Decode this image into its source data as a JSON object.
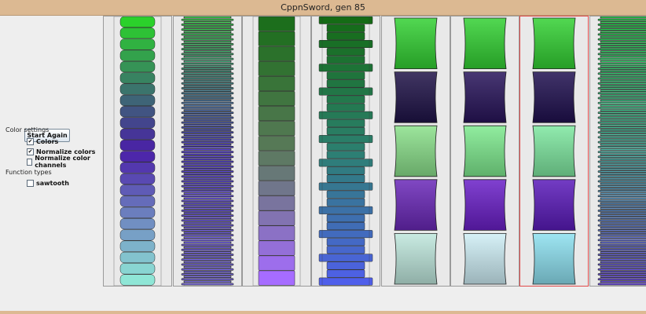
{
  "window": {
    "title": "CppnSword, gen 85"
  },
  "sidebar": {
    "start_again_label": "Start Again",
    "color_settings_label": "Color settings",
    "color_options": [
      {
        "label": "Colors",
        "checked": true
      },
      {
        "label": "Normalize colors",
        "checked": true
      },
      {
        "label": "Normalize color channels",
        "checked": false
      }
    ],
    "function_types_label": "Function types",
    "function_options": [
      {
        "label": "sawtooth",
        "checked": false
      }
    ]
  },
  "gallery": {
    "selected_index": 6,
    "panels": [
      {
        "name": "sword-0",
        "pattern": "waves",
        "colors": [
          "#2bd12b",
          "#4a1ea8",
          "#8fe6d6"
        ]
      },
      {
        "name": "sword-1",
        "pattern": "fine",
        "colors": [
          "#3ccc4a",
          "#5540c8",
          "#7c6ee0"
        ]
      },
      {
        "name": "sword-2",
        "pattern": "blocks",
        "colors": [
          "#1c6e1c",
          "#5a7a5a",
          "#a66cff"
        ]
      },
      {
        "name": "sword-3",
        "pattern": "stripes",
        "colors": [
          "#156b15",
          "#2c8070",
          "#4f5fea"
        ]
      },
      {
        "name": "sword-4",
        "pattern": "segments",
        "colors": [
          "#33d133",
          "#1f1248",
          "#8ae08a",
          "#6a28b8",
          "#bfe8dd"
        ]
      },
      {
        "name": "sword-5",
        "pattern": "segments",
        "colors": [
          "#33d133",
          "#28145a",
          "#7eea8e",
          "#6a1fc8",
          "#cfeef6"
        ]
      },
      {
        "name": "sword-6",
        "pattern": "segments",
        "colors": [
          "#33d133",
          "#201050",
          "#7ee8a0",
          "#5a1aba",
          "#8de0f0"
        ]
      },
      {
        "name": "sword-7",
        "pattern": "fine",
        "colors": [
          "#28c84a",
          "#4cb0a0",
          "#6a4bd8"
        ]
      }
    ]
  }
}
